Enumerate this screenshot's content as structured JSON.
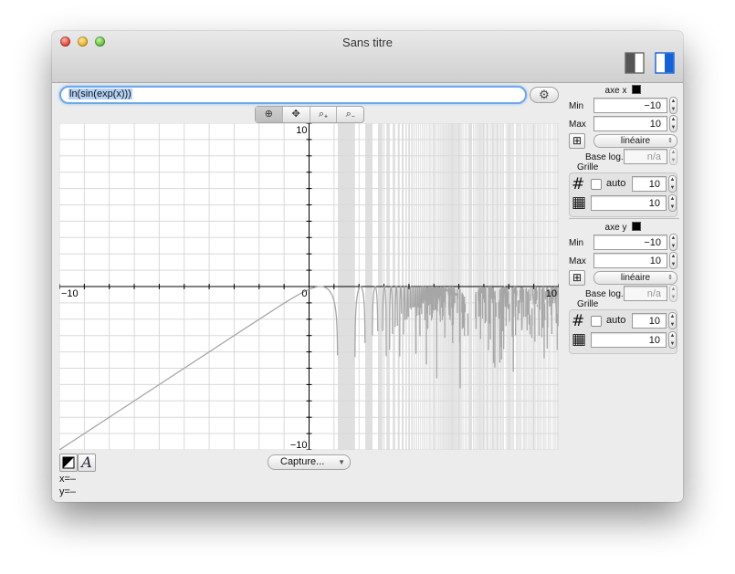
{
  "window": {
    "title": "Sans titre"
  },
  "toolbar": {
    "left_icon": "sidebar-left-icon",
    "right_icon": "sidebar-right-icon"
  },
  "expression": {
    "value": "ln(sin(exp(x)))",
    "gear_icon": "gear-icon"
  },
  "tools": [
    {
      "icon": "crosshair-icon",
      "glyph": "⊕",
      "active": true
    },
    {
      "icon": "move-icon",
      "glyph": "✥",
      "active": false
    },
    {
      "icon": "zoom-in-icon",
      "glyph": "⌕₊",
      "active": false
    },
    {
      "icon": "zoom-out-icon",
      "glyph": "⌕₋",
      "active": false
    }
  ],
  "plot": {
    "x_min_label": "−10",
    "x_max_label": "10",
    "x_zero_label": "0",
    "y_max_label": "10",
    "y_min_label": "−10",
    "function": "ln(sin(exp(x)))",
    "xlim": [
      -10,
      10
    ],
    "ylim": [
      -10,
      10
    ],
    "grid": true,
    "grid_step": 1,
    "axis_color": "#000000",
    "grid_color": "#d9d9d9",
    "curve_color": "#a6a6a6",
    "shade_color": "#dfdfdf"
  },
  "bottom": {
    "color_icon": "color-swatch-icon",
    "font_icon": "font-icon",
    "font_glyph": "A",
    "capture_label": "Capture...",
    "x_readout": "x=–",
    "y_readout": "y=–"
  },
  "axis_x": {
    "title": "axe x",
    "min_label": "Min",
    "min_value": "−10",
    "max_label": "Max",
    "max_value": "10",
    "scale": "linéaire",
    "log_base_label": "Base log.",
    "log_base_value": "n/a",
    "grid_label": "Grille",
    "auto_label": "auto",
    "major_value": "10",
    "minor_value": "10"
  },
  "axis_y": {
    "title": "axe y",
    "min_label": "Min",
    "min_value": "−10",
    "max_label": "Max",
    "max_value": "10",
    "scale": "linéaire",
    "log_base_label": "Base log.",
    "log_base_value": "n/a",
    "grid_label": "Grille",
    "auto_label": "auto",
    "major_value": "10",
    "minor_value": "10"
  }
}
